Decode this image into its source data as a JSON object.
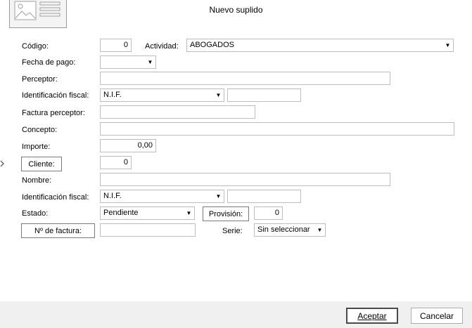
{
  "window": {
    "title": "Nuevo suplido"
  },
  "form": {
    "codigo": {
      "label": "Código:",
      "value": "0"
    },
    "actividad": {
      "label": "Actividad:",
      "value": "ABOGADOS"
    },
    "fecha_pago": {
      "label": "Fecha de pago:",
      "value": ""
    },
    "perceptor": {
      "label": "Perceptor:",
      "value": ""
    },
    "identificacion_perceptor": {
      "label": "Identificación fiscal:",
      "type_value": "N.I.F.",
      "value": ""
    },
    "factura_perceptor": {
      "label": "Factura perceptor:",
      "value": ""
    },
    "concepto": {
      "label": "Concepto:",
      "value": ""
    },
    "importe": {
      "label": "Importe:",
      "value": "0,00"
    },
    "cliente": {
      "button_label": "Cliente:",
      "value": "0"
    },
    "nombre": {
      "label": "Nombre:",
      "value": ""
    },
    "identificacion_cliente": {
      "label": "Identificación fiscal:",
      "type_value": "N.I.F.",
      "value": ""
    },
    "estado": {
      "label": "Estado:",
      "value": "Pendiente"
    },
    "provision": {
      "button_label": "Provisión:",
      "value": "0"
    },
    "n_factura": {
      "button_label": "Nº de factura:",
      "value": ""
    },
    "serie": {
      "label": "Serie:",
      "value": "Sin seleccionar"
    }
  },
  "footer": {
    "accept_label": "Aceptar",
    "cancel_label": "Cancelar"
  },
  "icons": {
    "header": "form-document-icon",
    "dropdown": "chevron-down-icon",
    "row_pointer": "chevron-right-icon"
  }
}
